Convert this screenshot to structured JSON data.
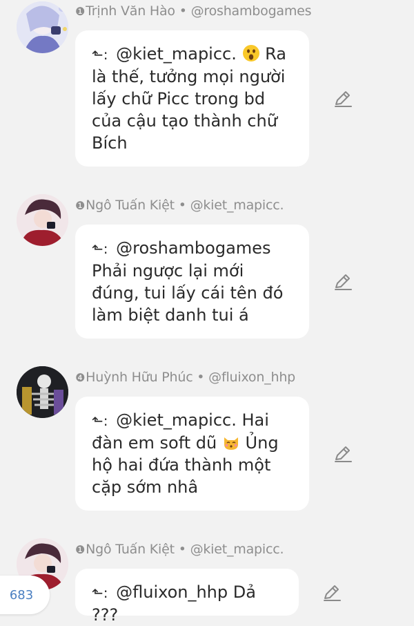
{
  "comments": [
    {
      "badge": "❶",
      "author": "Trịnh Văn Hào",
      "handle": "@roshambogames",
      "reply_to": "@kiet_mapicc.",
      "text_after_emoji": "Ra là thế, tưởng mọi người lấy chữ Picc trong bd của cậu tạo thành chữ Bích",
      "emoji": "astonished-face-emoji",
      "avatar": "avatar-anime-white-hair"
    },
    {
      "badge": "❶",
      "author": "Ngô Tuấn Kiệt",
      "handle": "@kiet_mapicc.",
      "reply_to": "@roshambogames",
      "text": "Phải ngược lại mới đúng, tui lấy cái tên đó làm biệt danh tui á",
      "avatar": "avatar-anime-red-coat"
    },
    {
      "badge": "❹",
      "author": "Huỳnh Hữu Phúc",
      "handle": "@fluixon_hhp",
      "reply_to": "@kiet_mapicc.",
      "text_before_emoji": "Hai đàn em soft dũ",
      "text_after_emoji": "Ủng hộ hai đứa thành một cặp sớm nhâ",
      "emoji": "kissing-cat-emoji",
      "avatar": "avatar-anime-skeleton"
    },
    {
      "badge": "❶",
      "author": "Ngô Tuấn Kiệt",
      "handle": "@kiet_mapicc.",
      "reply_to": "@fluixon_hhp",
      "text": "Dả ???",
      "avatar": "avatar-anime-red-coat"
    }
  ],
  "separator": "•",
  "reply_hook": "⬑:",
  "comment_count": "683",
  "icons": {
    "edit": "pencil-icon"
  },
  "colors": {
    "meta": "#8e8e8e",
    "count": "#4a7fc1",
    "background": "#f2f2f2",
    "bubble": "#ffffff"
  }
}
